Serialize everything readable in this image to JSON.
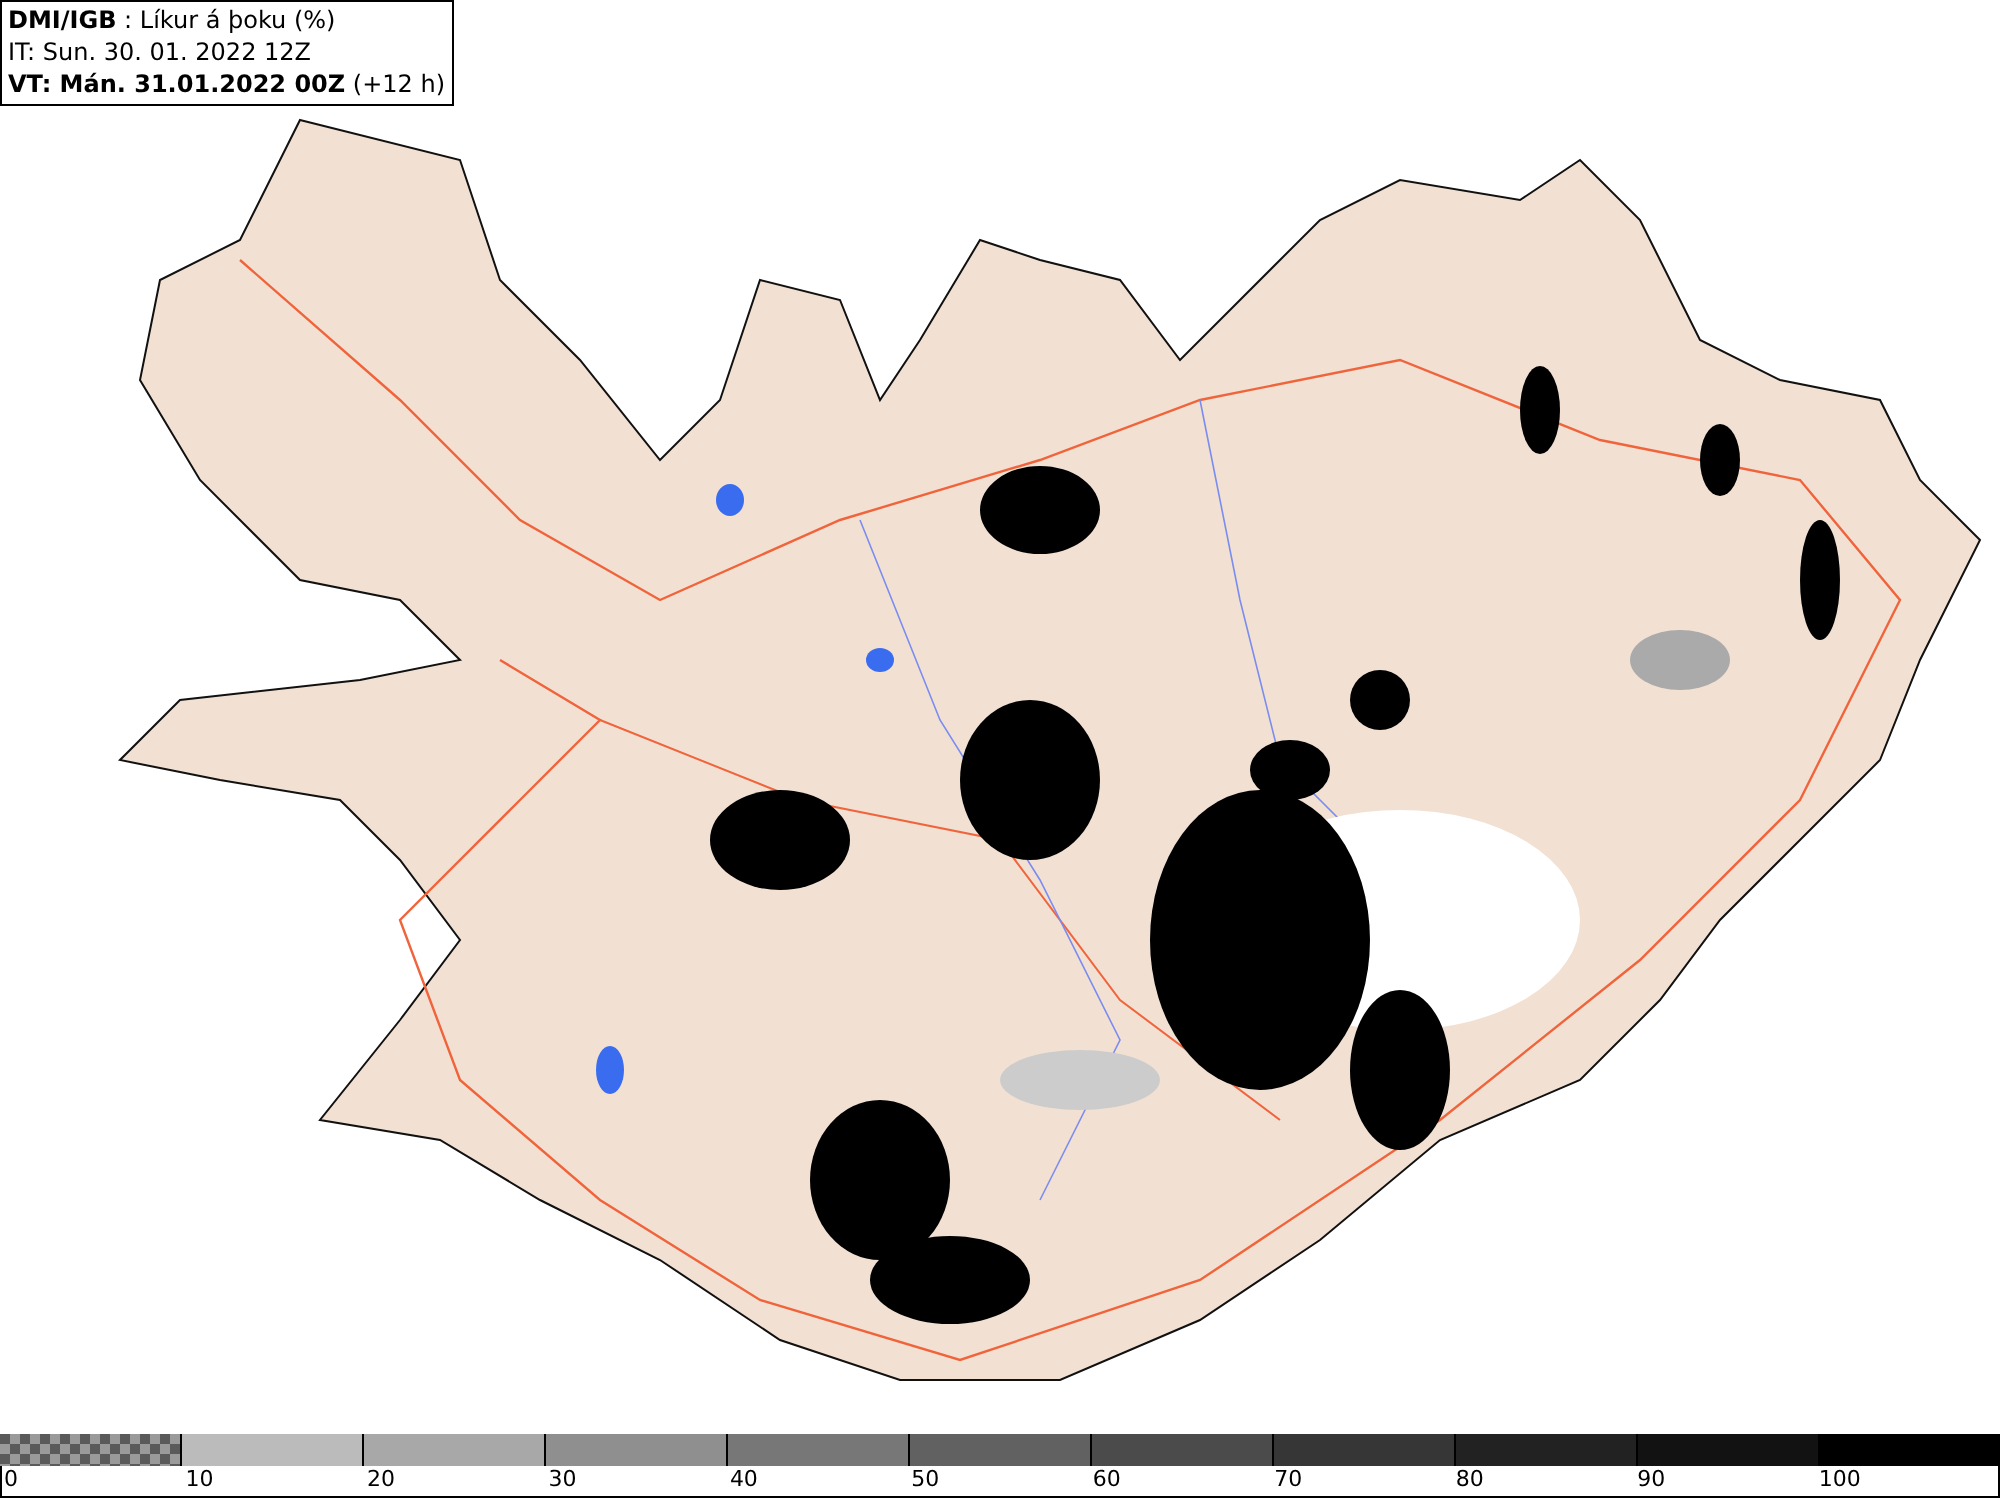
{
  "header": {
    "title": "**DMI/IGB** : Líkur á þoku (%)",
    "issue_time": "IT: Sun. 30. 01. 2022 12Z",
    "valid_time": "**VT: Mán. 31.01.2022 00Z** (+12 h)"
  },
  "legend": {
    "segments": [
      {
        "kind": "checker",
        "color": "#5a5a5a",
        "label": "0"
      },
      {
        "kind": "solid",
        "color": "#bbbbbb",
        "label": "10"
      },
      {
        "kind": "solid",
        "color": "#a8a8a8",
        "label": "20"
      },
      {
        "kind": "solid",
        "color": "#8f8f8f",
        "label": "30"
      },
      {
        "kind": "solid",
        "color": "#777777",
        "label": "40"
      },
      {
        "kind": "solid",
        "color": "#616161",
        "label": "50"
      },
      {
        "kind": "solid",
        "color": "#4b4b4b",
        "label": "60"
      },
      {
        "kind": "solid",
        "color": "#363636",
        "label": "70"
      },
      {
        "kind": "solid",
        "color": "#222222",
        "label": "80"
      },
      {
        "kind": "solid",
        "color": "#121212",
        "label": "90"
      },
      {
        "kind": "solid",
        "color": "#000000",
        "label": "100"
      }
    ]
  }
}
